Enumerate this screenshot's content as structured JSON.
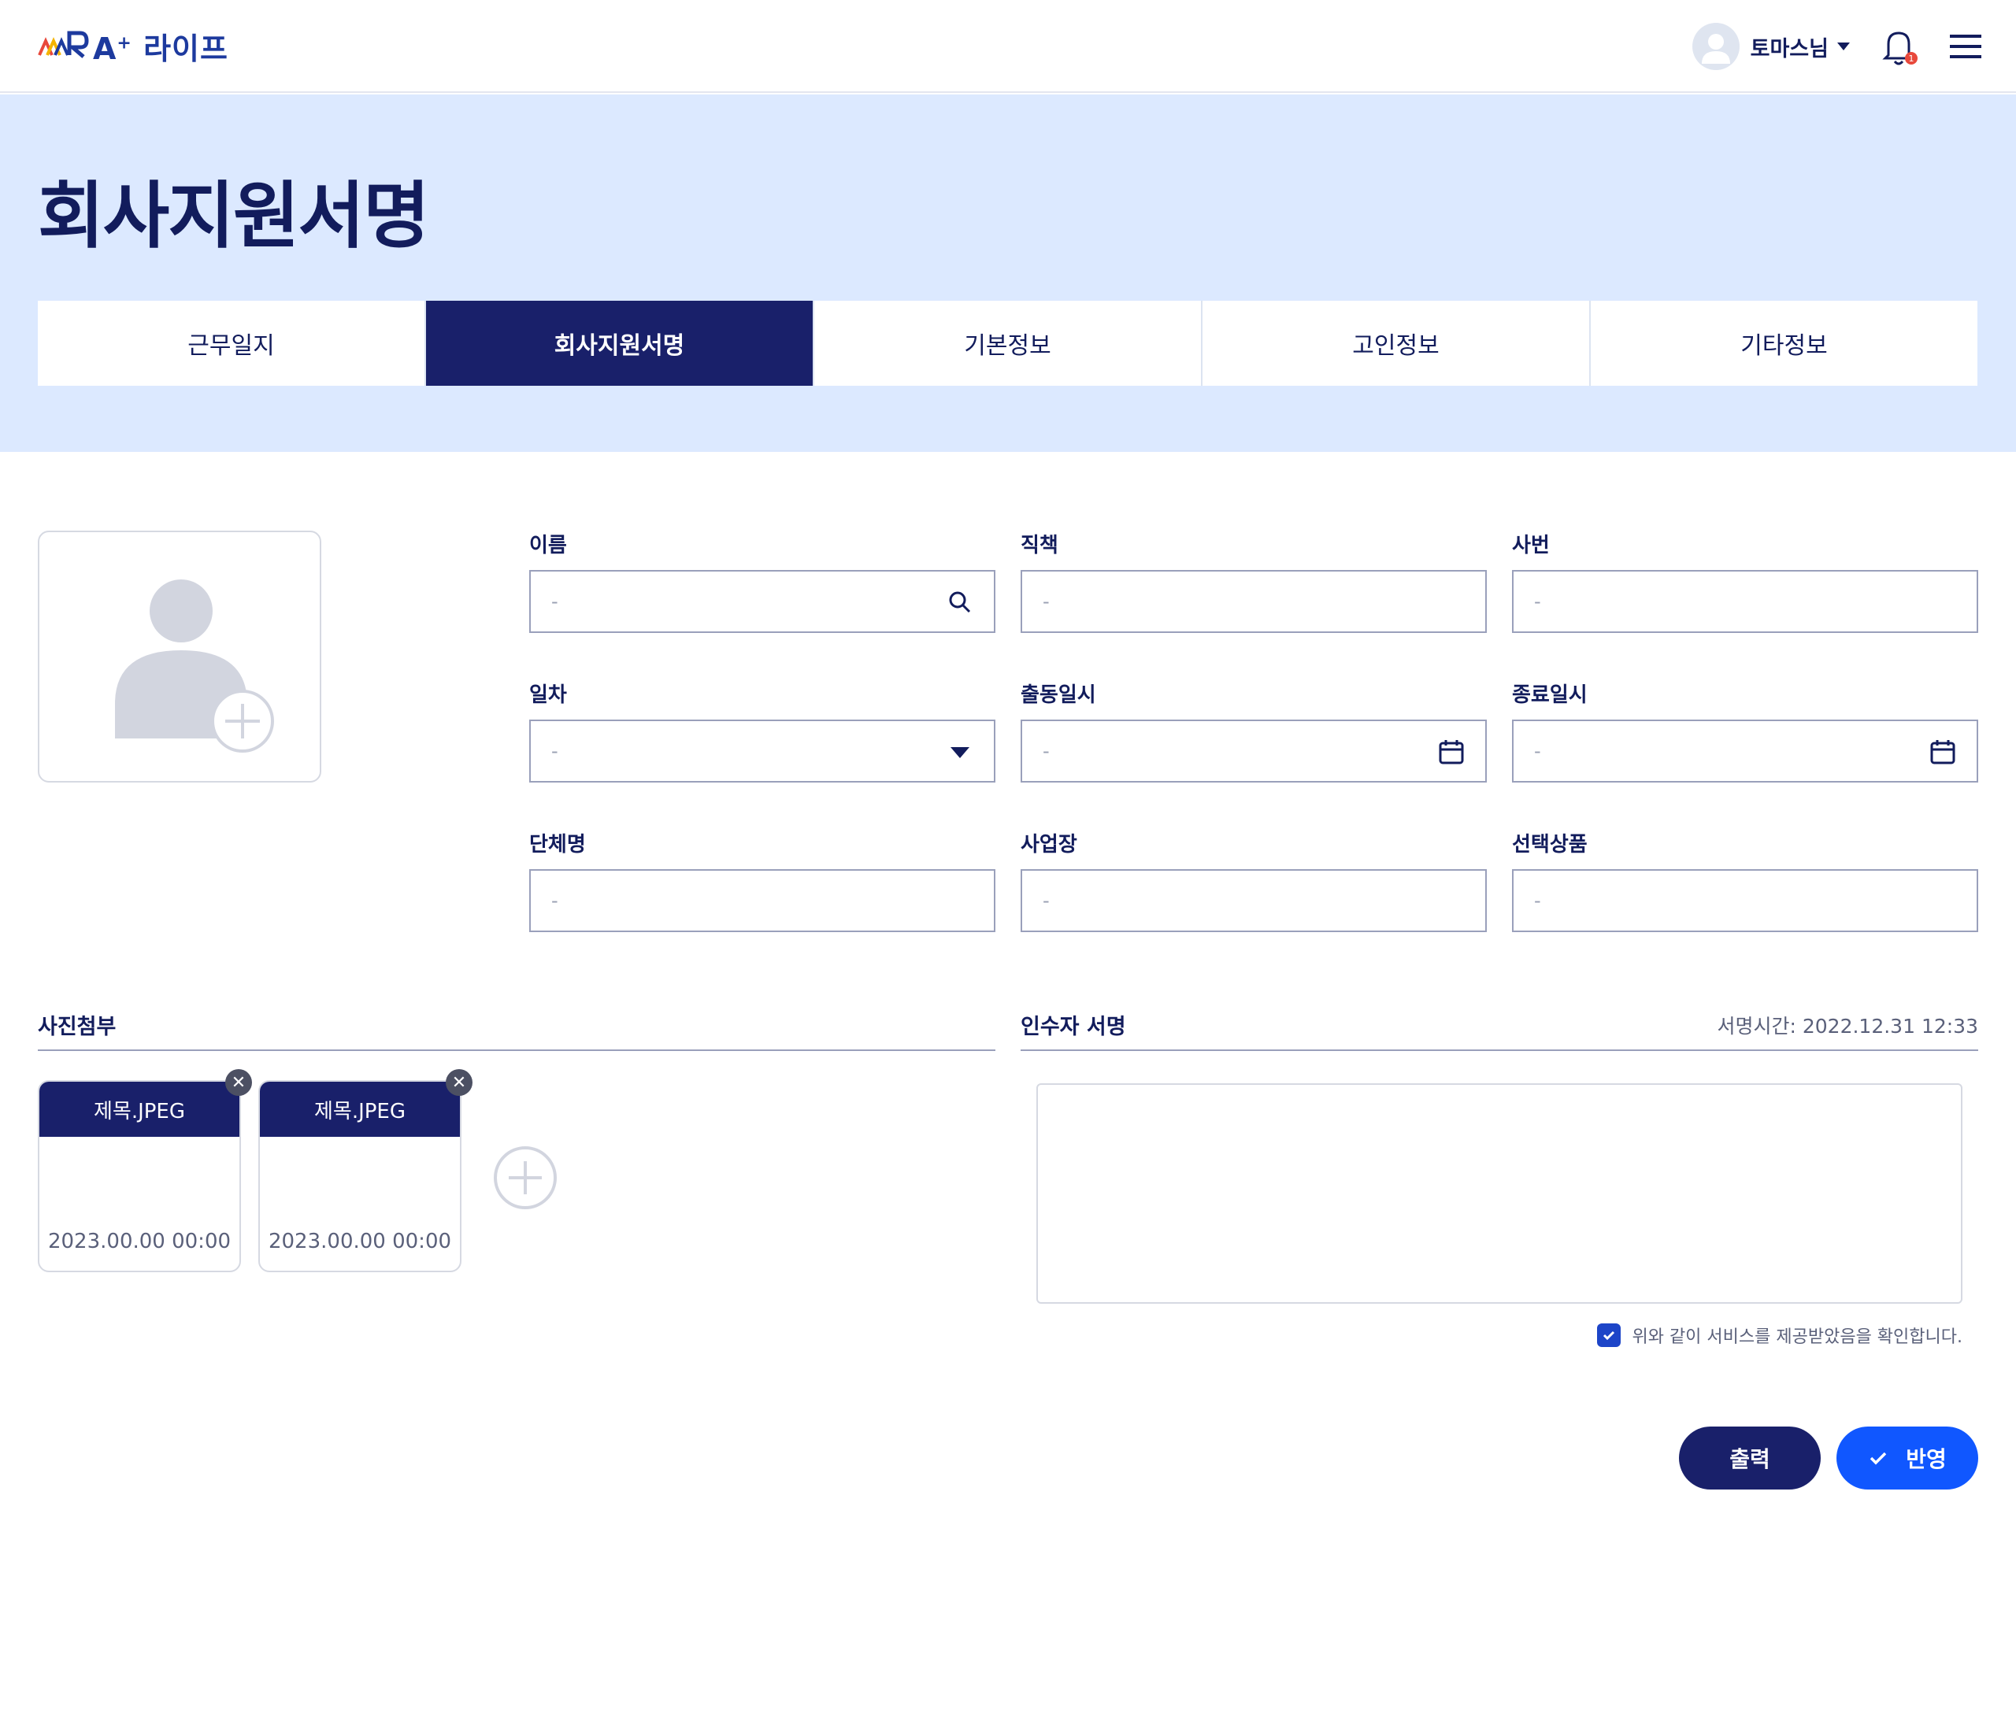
{
  "header": {
    "logo_text": "A",
    "logo_sup": "+",
    "logo_suffix": " 라이프",
    "logo_small": "A+LIFE",
    "user_name": "토마스님",
    "notification_count": "1"
  },
  "page": {
    "title": "회사지원서명"
  },
  "tabs": [
    {
      "label": "근무일지",
      "active": false
    },
    {
      "label": "회사지원서명",
      "active": true
    },
    {
      "label": "기본정보",
      "active": false
    },
    {
      "label": "고인정보",
      "active": false
    },
    {
      "label": "기타정보",
      "active": false
    }
  ],
  "form": {
    "name": {
      "label": "이름",
      "value": "-"
    },
    "position": {
      "label": "직책",
      "value": "-"
    },
    "employee_no": {
      "label": "사번",
      "value": "-"
    },
    "day": {
      "label": "일차",
      "value": "-"
    },
    "start_time": {
      "label": "출동일시",
      "value": "-"
    },
    "end_time": {
      "label": "종료일시",
      "value": "-"
    },
    "group_name": {
      "label": "단체명",
      "value": "-"
    },
    "workplace": {
      "label": "사업장",
      "value": "-"
    },
    "product": {
      "label": "선택상품",
      "value": "-"
    }
  },
  "attachments": {
    "title": "사진첨부",
    "items": [
      {
        "name": "제목.JPEG",
        "date": "2023.00.00 00:00"
      },
      {
        "name": "제목.JPEG",
        "date": "2023.00.00 00:00"
      }
    ]
  },
  "signature": {
    "title": "인수자 서명",
    "time_label": "서명시간: 2022.12.31 12:33",
    "confirm_text": "위와 같이 서비스를 제공받았음을 확인합니다.",
    "confirm_checked": true
  },
  "actions": {
    "print_label": "출력",
    "apply_label": "반영"
  },
  "colors": {
    "navy": "#19206a",
    "hero_bg": "#dce9ff",
    "primary_blue": "#1057ff",
    "border": "#9aa0bb"
  },
  "icons": [
    "search-icon",
    "chevron-down-icon",
    "calendar-icon",
    "bell-icon",
    "menu-icon",
    "close-icon",
    "plus-icon",
    "check-icon"
  ]
}
